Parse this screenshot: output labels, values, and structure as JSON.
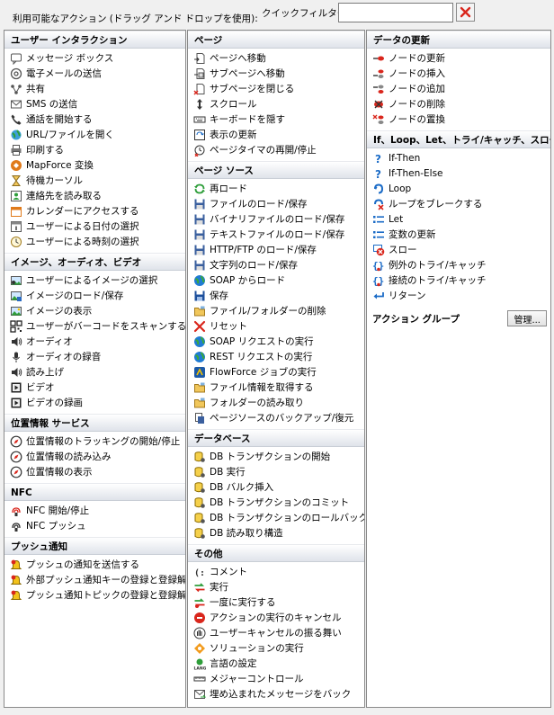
{
  "header": {
    "title": "利用可能なアクション (ドラッグ アンド ドロップを使用):",
    "quick_filter_label": "クイックフィルター:",
    "quick_filter_value": ""
  },
  "colors": {
    "accent_red": "#d9261c",
    "header_grad_bottom": "#dfe3ea",
    "border": "#8a8a8a"
  },
  "columns": [
    {
      "sections": [
        {
          "title": "ユーザー インタラクション",
          "items": [
            {
              "label": "メッセージ ボックス",
              "icon": "message-box-icon"
            },
            {
              "label": "電子メールの送信",
              "icon": "at-sign-icon"
            },
            {
              "label": "共有",
              "icon": "share-icon"
            },
            {
              "label": "SMS の送信",
              "icon": "envelope-icon"
            },
            {
              "label": "通話を開始する",
              "icon": "phone-icon"
            },
            {
              "label": "URL/ファイルを開く",
              "icon": "globe-icon"
            },
            {
              "label": "印刷する",
              "icon": "printer-icon"
            },
            {
              "label": "MapForce 変換",
              "icon": "mapforce-icon"
            },
            {
              "label": "待機カーソル",
              "icon": "hourglass-icon"
            },
            {
              "label": "連絡先を読み取る",
              "icon": "contact-icon"
            },
            {
              "label": "カレンダーにアクセスする",
              "icon": "calendar-icon"
            },
            {
              "label": "ユーザーによる日付の選択",
              "icon": "date-icon"
            },
            {
              "label": "ユーザーによる時刻の選択",
              "icon": "clock-icon"
            }
          ]
        },
        {
          "title": "イメージ、オーディオ、ビデオ",
          "items": [
            {
              "label": "ユーザーによるイメージの選択",
              "icon": "image-select-icon"
            },
            {
              "label": "イメージのロード/保存",
              "icon": "image-save-icon"
            },
            {
              "label": "イメージの表示",
              "icon": "image-icon"
            },
            {
              "label": "ユーザーがバーコードをスキャンする",
              "icon": "barcode-icon"
            },
            {
              "label": "オーディオ",
              "icon": "speaker-icon"
            },
            {
              "label": "オーディオの録音",
              "icon": "microphone-icon"
            },
            {
              "label": "読み上げ",
              "icon": "speaker-icon"
            },
            {
              "label": "ビデオ",
              "icon": "video-icon"
            },
            {
              "label": "ビデオの録画",
              "icon": "video-record-icon"
            }
          ]
        },
        {
          "title": "位置情報 サービス",
          "items": [
            {
              "label": "位置情報のトラッキングの開始/停止",
              "icon": "compass-icon"
            },
            {
              "label": "位置情報の読み込み",
              "icon": "compass-icon"
            },
            {
              "label": "位置情報の表示",
              "icon": "compass-icon"
            }
          ]
        },
        {
          "title": "NFC",
          "items": [
            {
              "label": "NFC 開始/停止",
              "icon": "nfc-icon"
            },
            {
              "label": "NFC プッシュ",
              "icon": "nfc-push-icon"
            }
          ]
        },
        {
          "title": "プッシュ通知",
          "items": [
            {
              "label": "プッシュの通知を送信する",
              "icon": "bell-icon"
            },
            {
              "label": "外部プッシュ通知キーの登録と登録解除",
              "icon": "bell-icon"
            },
            {
              "label": "プッシュ通知トピックの登録と登録解除",
              "icon": "bell-icon"
            }
          ]
        }
      ]
    },
    {
      "sections": [
        {
          "title": "ページ",
          "items": [
            {
              "label": "ページへ移動",
              "icon": "page-goto-icon"
            },
            {
              "label": "サブページへ移動",
              "icon": "subpage-goto-icon"
            },
            {
              "label": "サブページを閉じる",
              "icon": "subpage-close-icon"
            },
            {
              "label": "スクロール",
              "icon": "scroll-icon"
            },
            {
              "label": "キーボードを隠す",
              "icon": "keyboard-icon"
            },
            {
              "label": "表示の更新",
              "icon": "refresh-display-icon"
            },
            {
              "label": "ページタイマの再開/停止",
              "icon": "timer-icon"
            }
          ]
        },
        {
          "title": "ページ ソース",
          "items": [
            {
              "label": "再ロード",
              "icon": "reload-icon"
            },
            {
              "label": "ファイルのロード/保存",
              "icon": "disk-icon"
            },
            {
              "label": "バイナリファイルのロード/保存",
              "icon": "disk-icon"
            },
            {
              "label": "テキストファイルのロード/保存",
              "icon": "disk-icon"
            },
            {
              "label": "HTTP/FTP のロード/保存",
              "icon": "disk-icon"
            },
            {
              "label": "文字列のロード/保存",
              "icon": "disk-icon"
            },
            {
              "label": "SOAP からロード",
              "icon": "soap-icon"
            },
            {
              "label": "保存",
              "icon": "save-icon"
            },
            {
              "label": "ファイル/フォルダーの削除",
              "icon": "folder-icon"
            },
            {
              "label": "リセット",
              "icon": "reset-icon"
            },
            {
              "label": "SOAP リクエストの実行",
              "icon": "soap-icon"
            },
            {
              "label": "REST リクエストの実行",
              "icon": "soap-icon"
            },
            {
              "label": "FlowForce ジョブの実行",
              "icon": "flowforce-icon"
            },
            {
              "label": "ファイル情報を取得する",
              "icon": "folder-icon"
            },
            {
              "label": "フォルダーの読み取り",
              "icon": "folder-icon"
            },
            {
              "label": "ページソースのバックアップ/復元",
              "icon": "backup-icon"
            }
          ]
        },
        {
          "title": "データベース",
          "items": [
            {
              "label": "DB トランザクションの開始",
              "icon": "database-icon"
            },
            {
              "label": "DB 実行",
              "icon": "database-icon"
            },
            {
              "label": "DB バルク挿入",
              "icon": "database-icon"
            },
            {
              "label": "DB トランザクションのコミット",
              "icon": "database-icon"
            },
            {
              "label": "DB トランザクションのロールバック",
              "icon": "database-icon"
            },
            {
              "label": "DB 読み取り構造",
              "icon": "database-icon"
            }
          ]
        },
        {
          "title": "その他",
          "items": [
            {
              "label": "コメント",
              "icon": "comment-icon"
            },
            {
              "label": "実行",
              "icon": "execute-icon"
            },
            {
              "label": "一度に実行する",
              "icon": "execute-once-icon"
            },
            {
              "label": "アクションの実行のキャンセル",
              "icon": "stop-icon"
            },
            {
              "label": "ユーザーキャンセルの振る舞い",
              "icon": "hand-icon"
            },
            {
              "label": "ソリューションの実行",
              "icon": "solution-icon"
            },
            {
              "label": "言語の設定",
              "icon": "language-icon"
            },
            {
              "label": "メジャーコントロール",
              "icon": "ruler-icon"
            },
            {
              "label": "埋め込まれたメッセージをバック",
              "icon": "embedded-message-icon"
            }
          ]
        }
      ]
    },
    {
      "sections": [
        {
          "title": "データの更新",
          "items": [
            {
              "label": "ノードの更新",
              "icon": "node-update-icon"
            },
            {
              "label": "ノードの挿入",
              "icon": "node-insert-icon"
            },
            {
              "label": "ノードの追加",
              "icon": "node-append-icon"
            },
            {
              "label": "ノードの削除",
              "icon": "node-delete-icon"
            },
            {
              "label": "ノードの置換",
              "icon": "node-replace-icon"
            }
          ]
        },
        {
          "title": "If、Loop、Let、トライ/キャッチ、スロー",
          "items": [
            {
              "label": "If-Then",
              "icon": "question-icon"
            },
            {
              "label": "If-Then-Else",
              "icon": "question-icon"
            },
            {
              "label": "Loop",
              "icon": "loop-icon"
            },
            {
              "label": "ループをブレークする",
              "icon": "loop-break-icon"
            },
            {
              "label": "Let",
              "icon": "let-icon"
            },
            {
              "label": "変数の更新",
              "icon": "let-icon"
            },
            {
              "label": "スロー",
              "icon": "throw-icon"
            },
            {
              "label": "例外のトライ/キャッチ",
              "icon": "braces-icon"
            },
            {
              "label": "接続のトライ/キャッチ",
              "icon": "braces-icon"
            },
            {
              "label": "リターン",
              "icon": "return-icon"
            }
          ]
        }
      ],
      "group": {
        "label": "アクション グループ",
        "button": "管理..."
      }
    }
  ]
}
